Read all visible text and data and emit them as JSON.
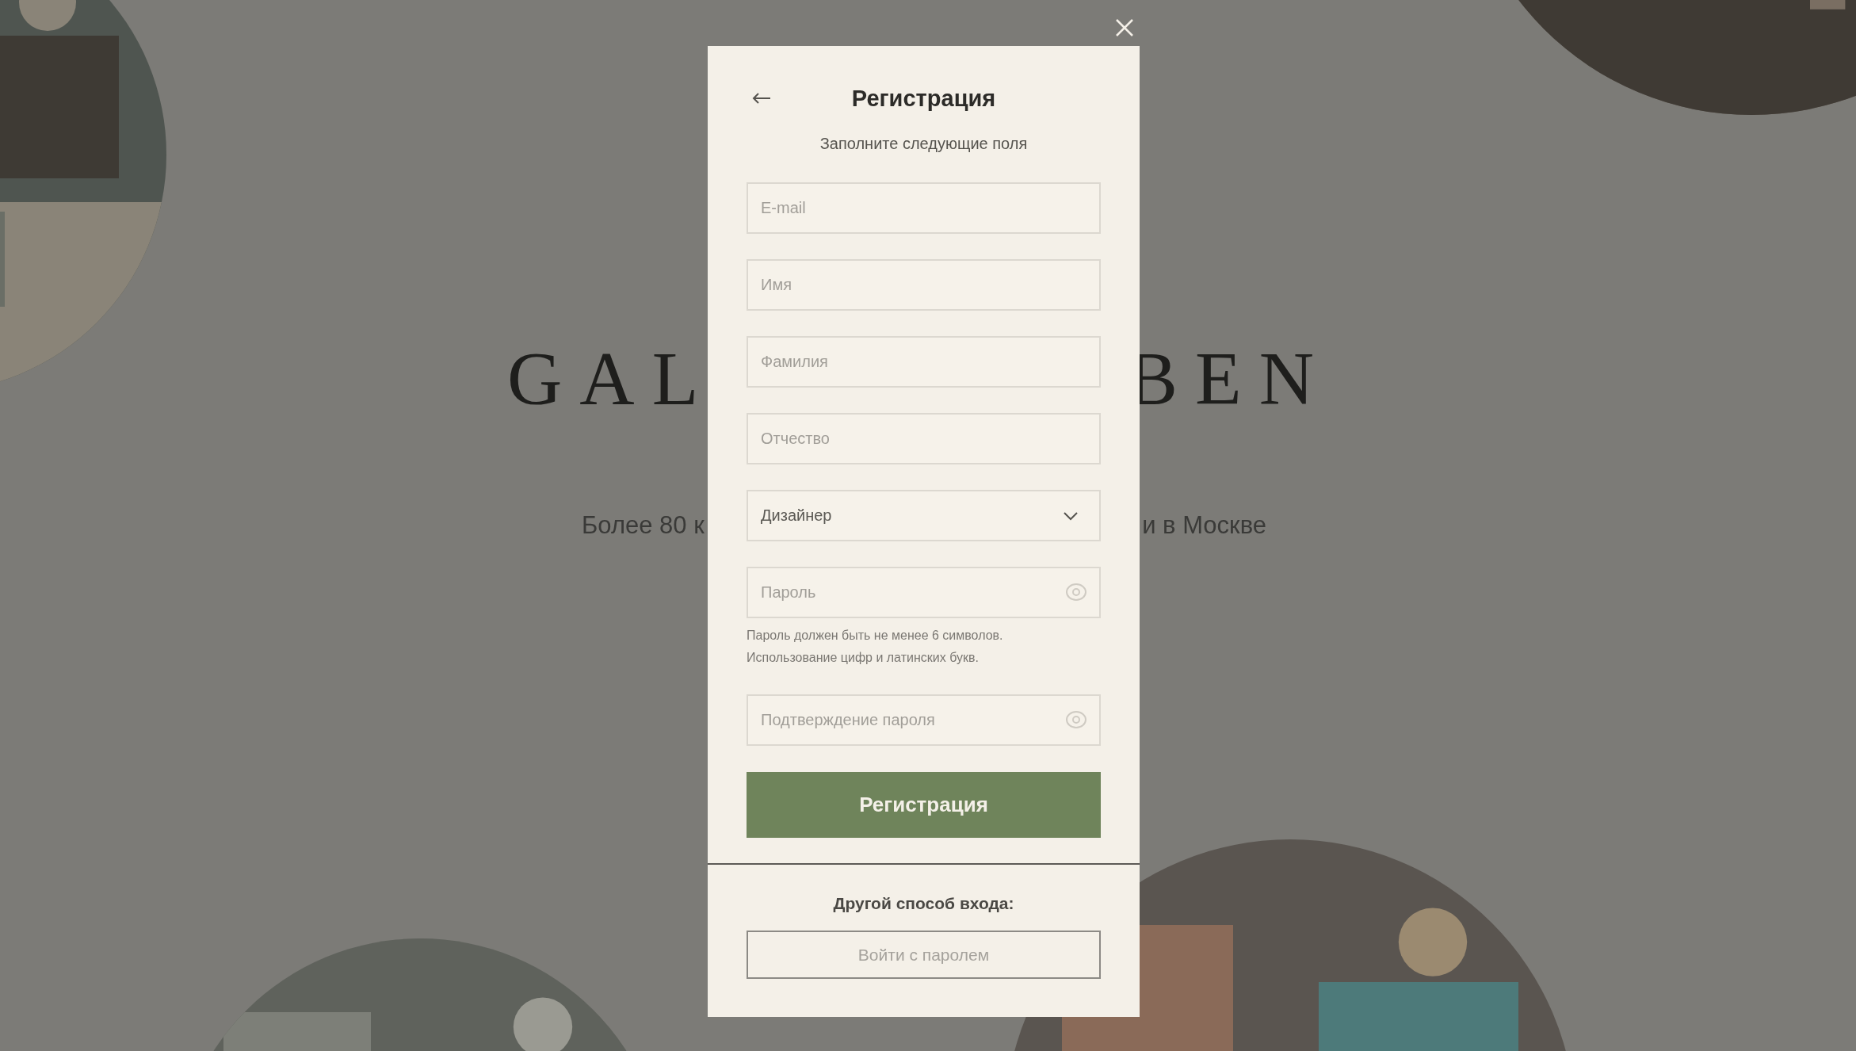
{
  "background": {
    "brand": [
      "GAL",
      "BEN"
    ],
    "tagline": [
      "Более 80 к",
      "и в Москве"
    ]
  },
  "modal": {
    "title": "Регистрация",
    "subtitle": "Заполните следующие поля",
    "fields": [
      {
        "kind": "text",
        "placeholder": "E-mail"
      },
      {
        "kind": "text",
        "placeholder": "Имя"
      },
      {
        "kind": "text",
        "placeholder": "Фамилия"
      },
      {
        "kind": "text",
        "placeholder": "Отчество"
      },
      {
        "kind": "select",
        "value": "Дизайнер"
      },
      {
        "kind": "password",
        "placeholder": "Пароль",
        "hint_lines": [
          "Пароль должен быть не менее 6 символов.",
          "Использование цифр и латинских букв."
        ]
      },
      {
        "kind": "password",
        "placeholder": "Подтверждение пароля"
      }
    ],
    "submit": "Регистрация",
    "alt_label": "Другой способ входа:",
    "alt_button": "Войти с паролем"
  }
}
